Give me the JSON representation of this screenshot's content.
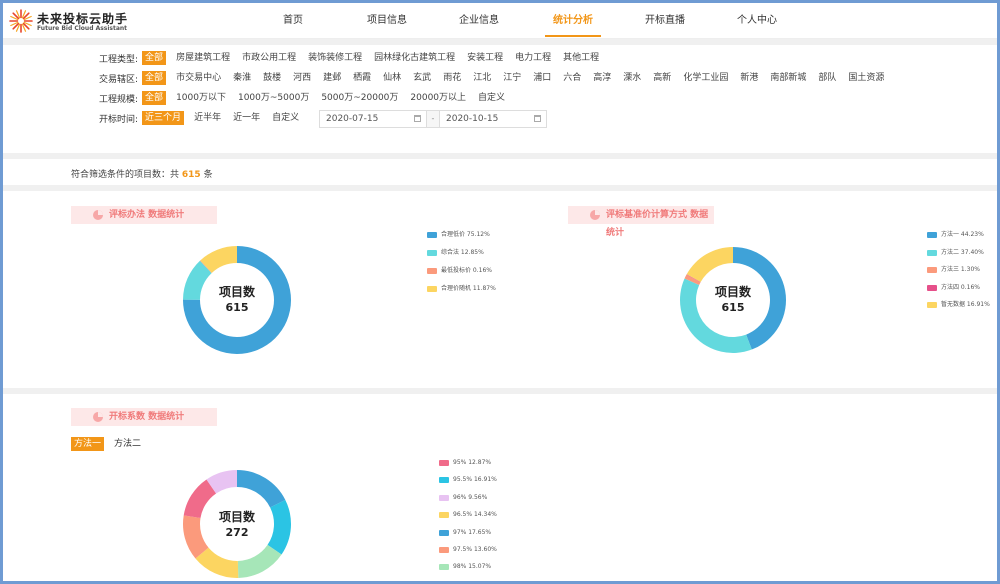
{
  "header": {
    "brand_cn": "未来投标云助手",
    "brand_en": "Future Bid Cloud Assistant",
    "nav": [
      "首页",
      "项目信息",
      "企业信息",
      "统计分析",
      "开标直播",
      "个人中心"
    ],
    "active_nav": "统计分析"
  },
  "filters": {
    "type": {
      "label": "工程类型:",
      "options": [
        "全部",
        "房屋建筑工程",
        "市政公用工程",
        "装饰装修工程",
        "园林绿化古建筑工程",
        "安装工程",
        "电力工程",
        "其他工程"
      ]
    },
    "area": {
      "label": "交易辖区:",
      "options": [
        "全部",
        "市交易中心",
        "秦淮",
        "鼓楼",
        "河西",
        "建邺",
        "栖霞",
        "仙林",
        "玄武",
        "雨花",
        "江北",
        "江宁",
        "浦口",
        "六合",
        "高淳",
        "溧水",
        "高新",
        "化学工业园",
        "新港",
        "南部新城",
        "部队",
        "国土资源"
      ]
    },
    "scale": {
      "label": "工程规模:",
      "options": [
        "全部",
        "1000万以下",
        "1000万~5000万",
        "5000万~20000万",
        "20000万以上",
        "自定义"
      ]
    },
    "time": {
      "label": "开标时间:",
      "options": [
        "近三个月",
        "近半年",
        "近一年",
        "自定义"
      ],
      "start": "2020-07-15",
      "end": "2020-10-15",
      "sep": "-"
    }
  },
  "summary": {
    "prefix": "符合筛选条件的项目数：共",
    "count": "615",
    "suffix": "条"
  },
  "center_label": "项目数",
  "chart_data": [
    {
      "type": "pie",
      "title": "评标办法 数据统计",
      "total": "615",
      "labels": [
        "合理低价",
        "综合法",
        "最低投标价",
        "合理价随机"
      ],
      "values": [
        75.12,
        12.85,
        0.16,
        11.87
      ],
      "value_text": [
        "75.12%",
        "12.85%",
        "0.16%",
        "11.87%"
      ],
      "colors": [
        "#3fa2d8",
        "#63d9de",
        "#fb9a7c",
        "#fcd561"
      ]
    },
    {
      "type": "pie",
      "title": "评标基准价计算方式 数据统计",
      "total": "615",
      "labels": [
        "方法一",
        "方法二",
        "方法三",
        "方法四",
        "暂无数据"
      ],
      "values": [
        44.23,
        37.4,
        1.3,
        0.16,
        16.91
      ],
      "value_text": [
        "44.23%",
        "37.40%",
        "1.30%",
        "0.16%",
        "16.91%"
      ],
      "colors": [
        "#3fa2d8",
        "#63d9de",
        "#fb9a7c",
        "#e6508a",
        "#fcd561"
      ]
    },
    {
      "type": "pie",
      "title": "开标系数 数据统计",
      "total": "272",
      "tabs": [
        "方法一",
        "方法二"
      ],
      "labels": [
        "95%",
        "95.5%",
        "96%",
        "96.5%",
        "97%",
        "97.5%",
        "98%"
      ],
      "values": [
        12.87,
        16.91,
        9.56,
        14.34,
        17.65,
        13.6,
        15.07
      ],
      "value_text": [
        "12.87%",
        "16.91%",
        "9.56%",
        "14.34%",
        "17.65%",
        "13.60%",
        "15.07%"
      ],
      "colors": [
        "#f06b8a",
        "#2bc4e4",
        "#e8c3f2",
        "#fcd561",
        "#3fa2d8",
        "#fb9a7c",
        "#a6e6b8"
      ],
      "ring_order": [
        4,
        1,
        6,
        3,
        5,
        0,
        2
      ]
    }
  ]
}
